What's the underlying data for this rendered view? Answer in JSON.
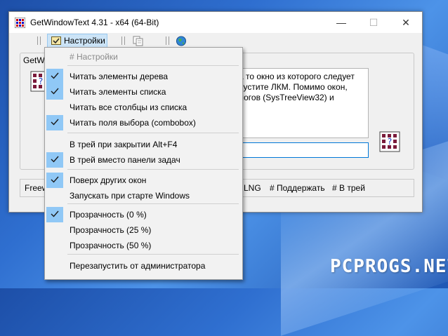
{
  "window": {
    "title": "GetWindowText 4.31 - x64 (64-Bit)",
    "minimize": "—",
    "maximize": "☐",
    "close": "✕"
  },
  "toolbar": {
    "settings_label": "Настройки",
    "icons": [
      "settings-icon",
      "copy-icon",
      "globe-icon"
    ]
  },
  "main": {
    "group_label": "GetWi",
    "description": "а то окно из которого следует\nпустите ЛКМ. Помимо окон,\nлогов (SysTreeView32) и",
    "text_value": ""
  },
  "statusbar": {
    "left": "Freew",
    "items": [
      "LNG",
      "# Поддержать",
      "# В трей"
    ]
  },
  "menu": {
    "header": "# Настройки",
    "items": [
      {
        "label": "Читать элементы дерева",
        "checked": true
      },
      {
        "label": "Читать элементы списка",
        "checked": true
      },
      {
        "label": "Читать все столбцы из списка",
        "checked": false
      },
      {
        "label": "Читать поля выбора (combobox)",
        "checked": true
      },
      {
        "label": "В трей при закрытии Alt+F4",
        "checked": false
      },
      {
        "label": "В трей вместо панели задач",
        "checked": true
      },
      {
        "label": "Поверх других окон",
        "checked": true
      },
      {
        "label": "Запускать при старте Windows",
        "checked": false
      },
      {
        "label": "Прозрачность (0 %)",
        "checked": true
      },
      {
        "label": "Прозрачность (25 %)",
        "checked": false
      },
      {
        "label": "Прозрачность (50 %)",
        "checked": false
      },
      {
        "label": "Перезапустить от администратора",
        "checked": false
      }
    ]
  },
  "watermark": "PCPROGS.NET",
  "colors": {
    "menu_check_bg": "#90c8f6",
    "toolbar_active": "#cce4f7",
    "input_focus": "#0078d7"
  }
}
